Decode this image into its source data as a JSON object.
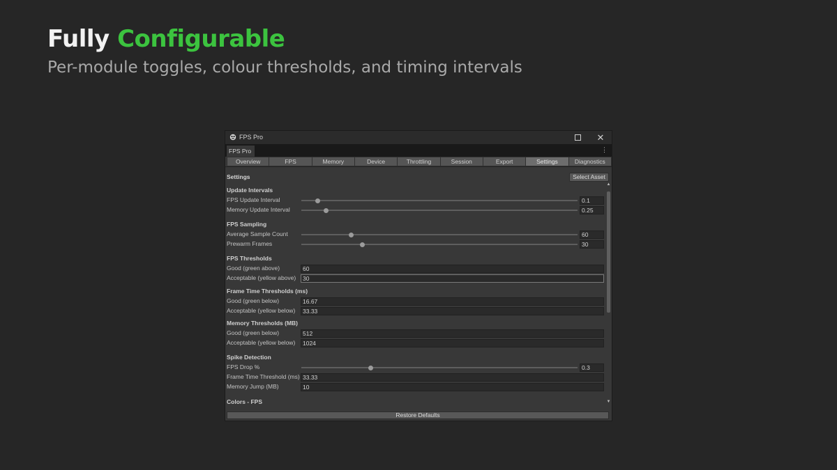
{
  "hero": {
    "title_plain": "Fully",
    "title_accent": "Configurable",
    "subtitle": "Per-module toggles, colour thresholds, and timing intervals",
    "accent_color": "#3cc33f"
  },
  "window": {
    "title": "FPS Pro",
    "icon": "fps-pro-logo-icon",
    "dock_tab": "FPS Pro",
    "tabs": [
      "Overview",
      "FPS",
      "Memory",
      "Device",
      "Throttling",
      "Session",
      "Export",
      "Settings",
      "Diagnostics"
    ],
    "active_tab": "Settings"
  },
  "settings": {
    "title": "Settings",
    "select_asset_label": "Select Asset",
    "restore_defaults_label": "Restore Defaults",
    "update_intervals": {
      "title": "Update Intervals",
      "fps_update_interval": {
        "label": "FPS Update Interval",
        "value": "0.1",
        "slider_fraction": 0.06
      },
      "memory_update_interval": {
        "label": "Memory Update Interval",
        "value": "0.25",
        "slider_fraction": 0.09
      }
    },
    "fps_sampling": {
      "title": "FPS Sampling",
      "average_sample_count": {
        "label": "Average Sample Count",
        "value": "60",
        "slider_fraction": 0.18
      },
      "prewarm_frames": {
        "label": "Prewarm Frames",
        "value": "30",
        "slider_fraction": 0.22
      }
    },
    "fps_thresholds": {
      "title": "FPS Thresholds",
      "good": {
        "label": "Good (green above)",
        "value": "60"
      },
      "acceptable": {
        "label": "Acceptable (yellow above)",
        "value": "30"
      }
    },
    "frame_time_thresholds": {
      "title": "Frame Time Thresholds (ms)",
      "good": {
        "label": "Good (green below)",
        "value": "16.67"
      },
      "acceptable": {
        "label": "Acceptable (yellow below)",
        "value": "33.33"
      }
    },
    "memory_thresholds": {
      "title": "Memory Thresholds (MB)",
      "good": {
        "label": "Good (green below)",
        "value": "512"
      },
      "acceptable": {
        "label": "Acceptable (yellow below)",
        "value": "1024"
      }
    },
    "spike_detection": {
      "title": "Spike Detection",
      "fps_drop": {
        "label": "FPS Drop %",
        "value": "0.3",
        "slider_fraction": 0.25
      },
      "frame_time_threshold": {
        "label": "Frame Time Threshold (ms)",
        "value": "33.33"
      },
      "memory_jump": {
        "label": "Memory Jump (MB)",
        "value": "10"
      }
    },
    "colors_fps": {
      "title": "Colors - FPS"
    }
  }
}
